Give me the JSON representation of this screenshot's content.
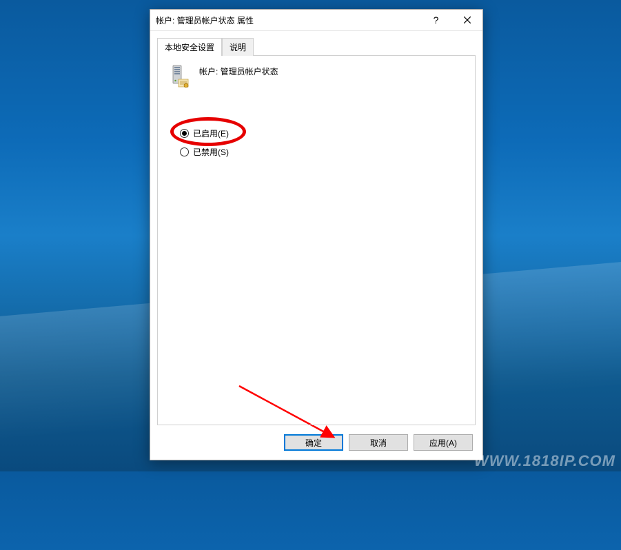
{
  "dialog": {
    "title": "帐户: 管理员帐户状态 属性",
    "help_symbol": "?",
    "tabs": [
      {
        "label": "本地安全设置",
        "active": true
      },
      {
        "label": "说明",
        "active": false
      }
    ],
    "policy_header": "帐户: 管理员帐户状态",
    "radios": {
      "enabled": {
        "label": "已启用(E)",
        "checked": true
      },
      "disabled": {
        "label": "已禁用(S)",
        "checked": false
      }
    },
    "buttons": {
      "ok": "确定",
      "cancel": "取消",
      "apply": "应用(A)"
    }
  },
  "watermark": "WWW.1818IP.COM"
}
